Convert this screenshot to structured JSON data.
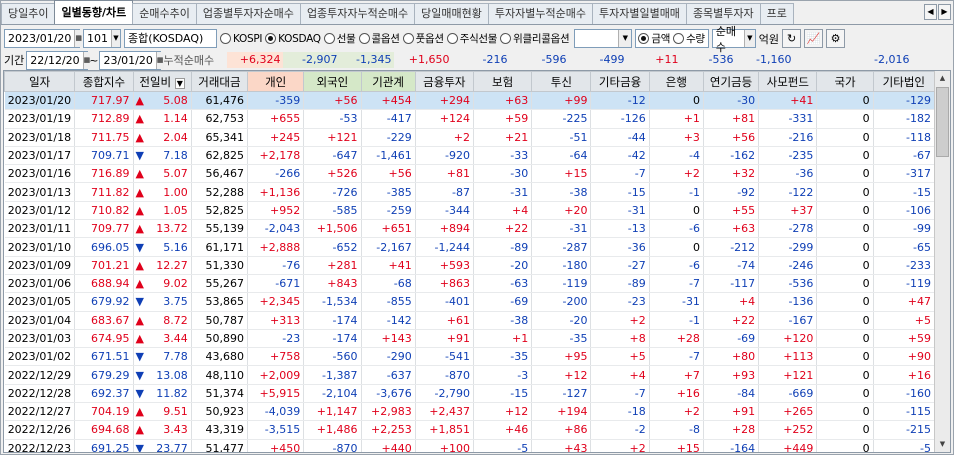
{
  "tabs": [
    "당일추이",
    "일별동향/차트",
    "순매수추이",
    "업종별투자자순매수",
    "업종투자자누적순매수",
    "당일매매현황",
    "투자자별누적순매수",
    "투자자별일별매매",
    "종목별투자자",
    "프로"
  ],
  "toolbar": {
    "date": "2023/01/20",
    "code": "101",
    "market_name": "종합(KOSDAQ)",
    "radios": [
      "KOSPI",
      "KOSDAQ",
      "선물",
      "콜옵션",
      "풋옵션",
      "주식선물",
      "위클리콜옵션"
    ],
    "radio_selected": "KOSDAQ",
    "amount_radios": [
      "금액",
      "수량"
    ],
    "amount_selected": "금액",
    "order_select": "순매수",
    "unit": "억원",
    "icons": [
      "refresh-icon",
      "chart-icon",
      "settings-icon"
    ]
  },
  "period": {
    "label": "기간",
    "from": "22/12/20",
    "to": "23/01/20",
    "cum_label": "누적순매수",
    "sums": [
      "+6,324",
      "-2,907",
      "-1,345",
      "+1,650",
      "-216",
      "-596",
      "-499",
      "+11",
      "-536",
      "-1,160",
      "",
      "-2,016"
    ]
  },
  "grid": {
    "columns": [
      "일자",
      "종합지수",
      "전일비",
      "거래대금",
      "개인",
      "외국인",
      "기관계",
      "금융투자",
      "보험",
      "투신",
      "기타금융",
      "은행",
      "연기금등",
      "사모펀드",
      "국가",
      "기타법인"
    ],
    "rows": [
      [
        "2023/01/20",
        "717.97",
        "up",
        "5.08",
        "61,476",
        "-359",
        "+56",
        "+454",
        "+294",
        "+63",
        "+99",
        "-12",
        "0",
        "-30",
        "+41",
        "0",
        "-129"
      ],
      [
        "2023/01/19",
        "712.89",
        "up",
        "1.14",
        "62,753",
        "+655",
        "-53",
        "-417",
        "+124",
        "+59",
        "-225",
        "-126",
        "+1",
        "+81",
        "-331",
        "0",
        "-182"
      ],
      [
        "2023/01/18",
        "711.75",
        "up",
        "2.04",
        "65,341",
        "+245",
        "+121",
        "-229",
        "+2",
        "+21",
        "-51",
        "-44",
        "+3",
        "+56",
        "-216",
        "0",
        "-118"
      ],
      [
        "2023/01/17",
        "709.71",
        "dn",
        "7.18",
        "62,825",
        "+2,178",
        "-647",
        "-1,461",
        "-920",
        "-33",
        "-64",
        "-42",
        "-4",
        "-162",
        "-235",
        "0",
        "-67"
      ],
      [
        "2023/01/16",
        "716.89",
        "up",
        "5.07",
        "56,467",
        "-266",
        "+526",
        "+56",
        "+81",
        "-30",
        "+15",
        "-7",
        "+2",
        "+32",
        "-36",
        "0",
        "-317"
      ],
      [
        "2023/01/13",
        "711.82",
        "up",
        "1.00",
        "52,288",
        "+1,136",
        "-726",
        "-385",
        "-87",
        "-31",
        "-38",
        "-15",
        "-1",
        "-92",
        "-122",
        "0",
        "-15"
      ],
      [
        "2023/01/12",
        "710.82",
        "up",
        "1.05",
        "52,825",
        "+952",
        "-585",
        "-259",
        "-344",
        "+4",
        "+20",
        "-31",
        "0",
        "+55",
        "+37",
        "0",
        "-106"
      ],
      [
        "2023/01/11",
        "709.77",
        "up",
        "13.72",
        "55,139",
        "-2,043",
        "+1,506",
        "+651",
        "+894",
        "+22",
        "-31",
        "-13",
        "-6",
        "+63",
        "-278",
        "0",
        "-99"
      ],
      [
        "2023/01/10",
        "696.05",
        "dn",
        "5.16",
        "61,171",
        "+2,888",
        "-652",
        "-2,167",
        "-1,244",
        "-89",
        "-287",
        "-36",
        "0",
        "-212",
        "-299",
        "0",
        "-65"
      ],
      [
        "2023/01/09",
        "701.21",
        "up",
        "12.27",
        "51,330",
        "-76",
        "+281",
        "+41",
        "+593",
        "-20",
        "-180",
        "-27",
        "-6",
        "-74",
        "-246",
        "0",
        "-233"
      ],
      [
        "2023/01/06",
        "688.94",
        "up",
        "9.02",
        "55,267",
        "-671",
        "+843",
        "-68",
        "+863",
        "-63",
        "-119",
        "-89",
        "-7",
        "-117",
        "-536",
        "0",
        "-119"
      ],
      [
        "2023/01/05",
        "679.92",
        "dn",
        "3.75",
        "53,865",
        "+2,345",
        "-1,534",
        "-855",
        "-401",
        "-69",
        "-200",
        "-23",
        "-31",
        "+4",
        "-136",
        "0",
        "+47"
      ],
      [
        "2023/01/04",
        "683.67",
        "up",
        "8.72",
        "50,787",
        "+313",
        "-174",
        "-142",
        "+61",
        "-38",
        "-20",
        "+2",
        "-1",
        "+22",
        "-167",
        "0",
        "+5"
      ],
      [
        "2023/01/03",
        "674.95",
        "up",
        "3.44",
        "50,890",
        "-23",
        "-174",
        "+143",
        "+91",
        "+1",
        "-35",
        "+8",
        "+28",
        "-69",
        "+120",
        "0",
        "+59"
      ],
      [
        "2023/01/02",
        "671.51",
        "dn",
        "7.78",
        "43,680",
        "+758",
        "-560",
        "-290",
        "-541",
        "-35",
        "+95",
        "+5",
        "-7",
        "+80",
        "+113",
        "0",
        "+90"
      ],
      [
        "2022/12/29",
        "679.29",
        "dn",
        "13.08",
        "48,110",
        "+2,009",
        "-1,387",
        "-637",
        "-870",
        "-3",
        "+12",
        "+4",
        "+7",
        "+93",
        "+121",
        "0",
        "+16"
      ],
      [
        "2022/12/28",
        "692.37",
        "dn",
        "11.82",
        "51,374",
        "+5,915",
        "-2,104",
        "-3,676",
        "-2,790",
        "-15",
        "-127",
        "-7",
        "+16",
        "-84",
        "-669",
        "0",
        "-160"
      ],
      [
        "2022/12/27",
        "704.19",
        "up",
        "9.51",
        "50,923",
        "-4,039",
        "+1,147",
        "+2,983",
        "+2,437",
        "+12",
        "+194",
        "-18",
        "+2",
        "+91",
        "+265",
        "0",
        "-115"
      ],
      [
        "2022/12/26",
        "694.68",
        "up",
        "3.43",
        "43,319",
        "-3,515",
        "+1,486",
        "+2,253",
        "+1,851",
        "+46",
        "+86",
        "-2",
        "-8",
        "+28",
        "+252",
        "0",
        "-215"
      ],
      [
        "2022/12/23",
        "691.25",
        "dn",
        "23.77",
        "51,477",
        "+450",
        "-870",
        "+440",
        "+100",
        "-5",
        "+43",
        "+2",
        "+15",
        "-164",
        "+449",
        "0",
        "-5"
      ]
    ]
  },
  "colors": {
    "up": "#e0001b",
    "down": "#0f3fb5",
    "selected_row": "#cde3f5"
  }
}
